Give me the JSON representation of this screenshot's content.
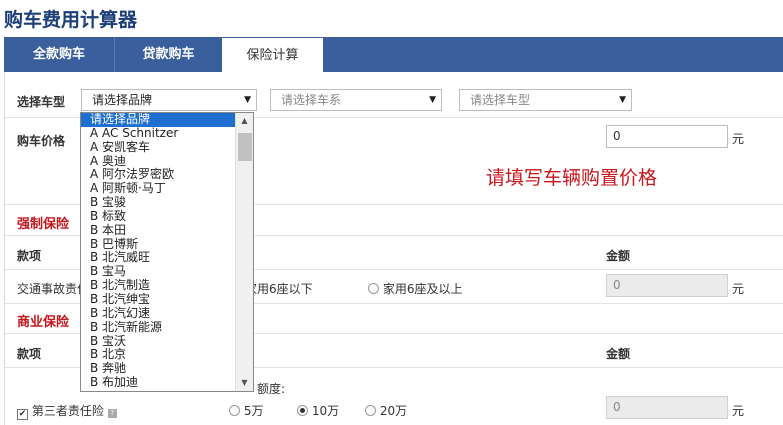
{
  "page": {
    "title": "购车费用计算器"
  },
  "tabs": [
    {
      "label": "全款购车",
      "active": false
    },
    {
      "label": "贷款购车",
      "active": false
    },
    {
      "label": "保险计算",
      "active": true
    }
  ],
  "select_row": {
    "label": "选择车型",
    "brand": "请选择品牌",
    "series": "请选择车系",
    "model": "请选择车型"
  },
  "price_row": {
    "label": "购车价格",
    "value": "0",
    "unit": "元",
    "hint": "请填写车辆购置价格"
  },
  "compulsory": {
    "section_title": "强制保险",
    "col_item": "款项",
    "col_amount": "金额",
    "item_label": "交通事故责任",
    "option_1": "家用6座以下",
    "option_2": "家用6座及以上",
    "value": "0",
    "unit": "元"
  },
  "commercial": {
    "section_title": "商业保险",
    "col_item": "款项",
    "col_amount": "金额",
    "third_party_label": "第三者责任险",
    "coverage_label": "额度:",
    "options": [
      "5万",
      "10万",
      "20万"
    ],
    "selected_option": "10万",
    "value": "0",
    "unit": "元"
  },
  "brand_dropdown": {
    "options": [
      "请选择品牌",
      "A AC Schnitzer",
      "A 安凯客车",
      "A 奥迪",
      "A 阿尔法罗密欧",
      "A 阿斯顿·马丁",
      "B 宝骏",
      "B 标致",
      "B 本田",
      "B 巴博斯",
      "B 北汽威旺",
      "B 宝马",
      "B 北汽制造",
      "B 北汽绅宝",
      "B 北汽幻速",
      "B 北汽新能源",
      "B 宝沃",
      "B 北京",
      "B 奔驰",
      "B 布加迪"
    ],
    "selected": "请选择品牌"
  },
  "colors": {
    "title": "#1c3f7a",
    "tabbar": "#3a5f9c",
    "accent_red": "#c8161d",
    "dropdown_highlight": "#1e6fd0"
  }
}
